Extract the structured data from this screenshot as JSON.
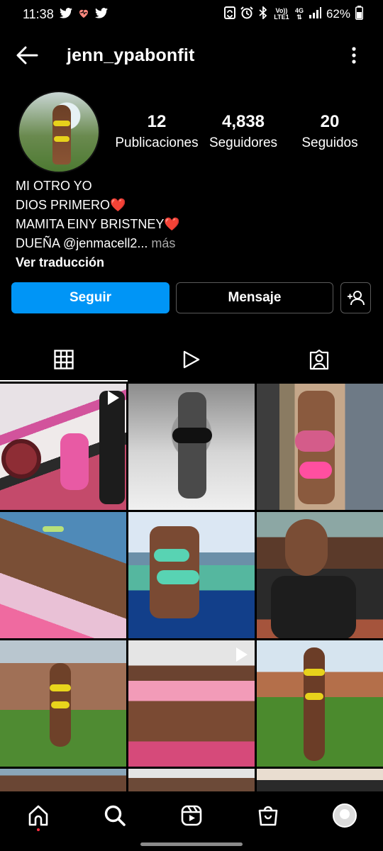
{
  "status_bar": {
    "time": "11:38",
    "battery": "62%",
    "left_icons": [
      "twitter-icon",
      "heart-pulse-icon",
      "twitter-icon"
    ],
    "right_icons": [
      "sync-icon",
      "alarm-icon",
      "bluetooth-icon",
      "volte-icon",
      "4g-icon",
      "signal-icon",
      "battery-icon"
    ],
    "volte_label": "Vo)) LTE1",
    "network_label": "4G"
  },
  "header": {
    "username": "jenn_ypabonfit"
  },
  "profile": {
    "stats": [
      {
        "value": "12",
        "label": "Publicaciones"
      },
      {
        "value": "4,838",
        "label": "Seguidores"
      },
      {
        "value": "20",
        "label": "Seguidos"
      }
    ],
    "bio_lines": [
      "MI OTRO YO",
      "DIOS PRIMERO❤️",
      "MAMITA EINY BRISTNEY❤️"
    ],
    "bio_last_line": "DUEÑA @jenmacell2...",
    "bio_more": " más",
    "translate_label": "Ver traducción"
  },
  "actions": {
    "follow_label": "Seguir",
    "message_label": "Mensaje"
  },
  "tabs": [
    {
      "name": "grid",
      "icon": "grid-icon",
      "selected": true
    },
    {
      "name": "reels",
      "icon": "play-icon",
      "selected": false
    },
    {
      "name": "tagged",
      "icon": "tagged-person-icon",
      "selected": false
    }
  ],
  "grid_posts": [
    {
      "kind": "reel"
    },
    {
      "kind": "photo"
    },
    {
      "kind": "photo"
    },
    {
      "kind": "photo"
    },
    {
      "kind": "photo"
    },
    {
      "kind": "photo"
    },
    {
      "kind": "photo"
    },
    {
      "kind": "reel"
    },
    {
      "kind": "photo"
    },
    {
      "kind": "photo"
    },
    {
      "kind": "photo"
    },
    {
      "kind": "photo"
    }
  ],
  "bottom_nav": [
    {
      "name": "home",
      "icon": "home-icon",
      "notification_dot": true
    },
    {
      "name": "search",
      "icon": "search-icon",
      "active": true
    },
    {
      "name": "reels",
      "icon": "reels-icon"
    },
    {
      "name": "shop",
      "icon": "shop-bag-icon"
    },
    {
      "name": "profile",
      "icon": "profile-avatar-icon"
    }
  ],
  "colors": {
    "background": "#000000",
    "primary_button": "#0095f6",
    "secondary_text": "#a8a8a8",
    "button_border": "#5a5a5a"
  }
}
